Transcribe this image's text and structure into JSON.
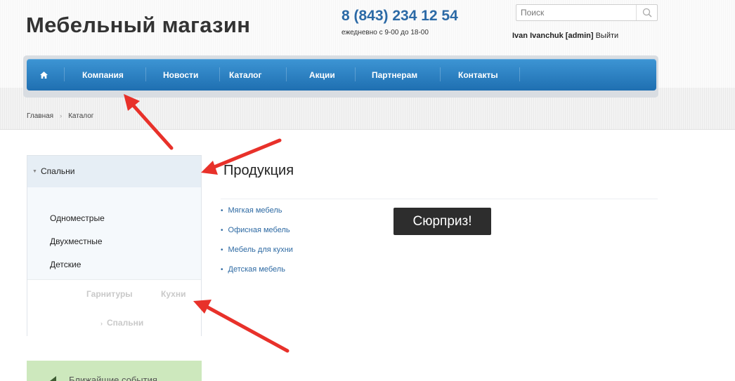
{
  "header": {
    "site_title": "Мебельный магазин",
    "phone": "8 (843) 234 12 54",
    "hours": "ежедневно с 9-00 до 18-00",
    "search": {
      "placeholder": "Поиск",
      "icon": "search-icon"
    },
    "user": {
      "name": "Ivan Ivanchuk [admin]",
      "logout": "Выйти"
    }
  },
  "nav": {
    "home_icon": "home-icon",
    "items": [
      {
        "label": "Компания"
      },
      {
        "label": "Новости"
      },
      {
        "label": "Каталог"
      },
      {
        "label": "Акции"
      },
      {
        "label": "Партнерам"
      },
      {
        "label": "Контакты"
      }
    ]
  },
  "breadcrumb": {
    "items": [
      "Главная",
      "Каталог"
    ],
    "separator": "›"
  },
  "sidebar": {
    "section_title": "Спальни",
    "items": [
      "Одноместрые",
      "Двухместные",
      "Детские"
    ],
    "footer_items": [
      "Гарнитуры",
      "Кухни",
      "Спальни"
    ]
  },
  "events": {
    "label": "Ближайшие события"
  },
  "main": {
    "title": "Продукция",
    "products": [
      "Мягкая мебель",
      "Офисная мебель",
      "Мебель для кухни",
      "Детская мебель"
    ]
  },
  "tooltip": {
    "text": "Сюрприз!"
  },
  "colors": {
    "nav_top": "#3d95d4",
    "nav_bottom": "#1f6fb1",
    "phone": "#2c6aa6",
    "link": "#2e6aa3",
    "arrow": "#e8312a",
    "tooltip_bg": "#2d2d2d",
    "events_bg": "#cde8bd"
  }
}
